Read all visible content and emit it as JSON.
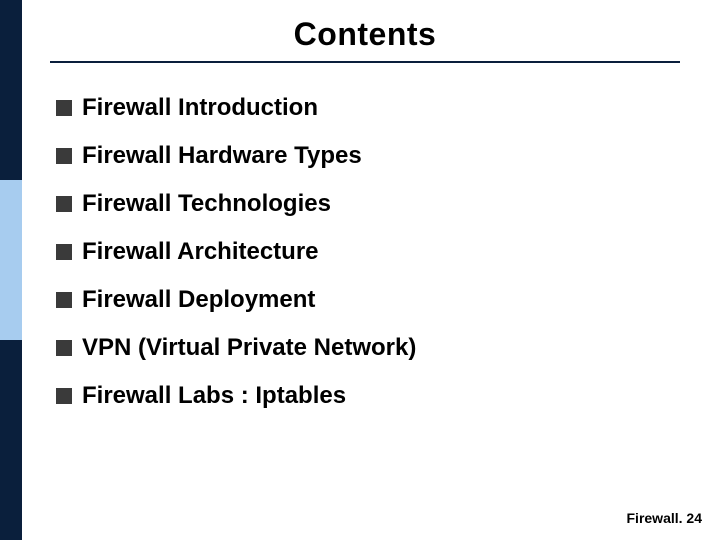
{
  "title": "Contents",
  "items": [
    "Firewall Introduction",
    "Firewall Hardware Types",
    "Firewall Technologies",
    "Firewall Architecture",
    "Firewall Deployment",
    "VPN (Virtual Private Network)",
    "Firewall Labs : Iptables"
  ],
  "footer": {
    "label": "Firewall.",
    "page": "24"
  },
  "colors": {
    "sidebar_dark": "#0a1f3c",
    "sidebar_light": "#a7ccef",
    "bullet": "#3a3a3a"
  }
}
